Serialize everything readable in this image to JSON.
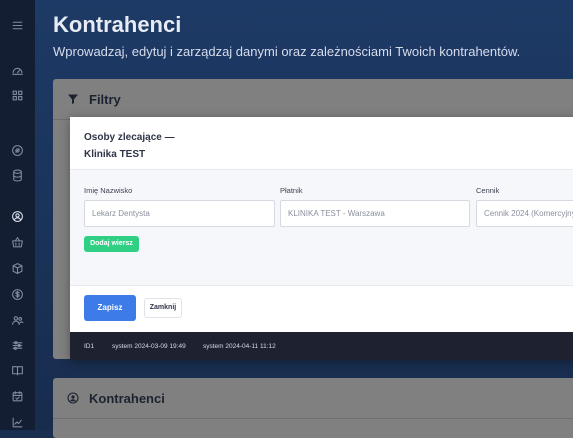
{
  "page": {
    "title": "Kontrahenci",
    "subtitle": "Wprowadzaj, edytuj i zarządzaj danymi oraz zależnościami Twoich kontrahentów."
  },
  "sidebar": {
    "icons": [
      "menu-icon",
      "dashboard-icon",
      "grid-icon",
      "target-icon",
      "database-icon",
      "user-circle-icon",
      "basket-icon",
      "box-icon",
      "dollar-icon",
      "users-icon",
      "sliders-icon",
      "book-icon",
      "calendar-check-icon",
      "chart-icon"
    ]
  },
  "filters": {
    "title": "Filtry"
  },
  "contractors": {
    "title": "Kontrahenci"
  },
  "modal": {
    "title_line1": "Osoby zlecające —",
    "title_line2": "Klinika TEST",
    "fields": [
      {
        "label": "Imię Nazwisko",
        "value": "Lekarz Dentysta"
      },
      {
        "label": "Płatnik",
        "value": "KLINIKA TEST - Warszawa"
      },
      {
        "label": "Cennik",
        "value": "Cennik 2024 (Komercyjny)"
      }
    ],
    "add_row_label": "Dodaj wiersz",
    "save_label": "Zapisz",
    "close_label": "Zamknij",
    "footer": {
      "id": "ID1",
      "created": "system 2024-03-09 19:49",
      "modified": "system 2024-04-11 11:12"
    }
  }
}
